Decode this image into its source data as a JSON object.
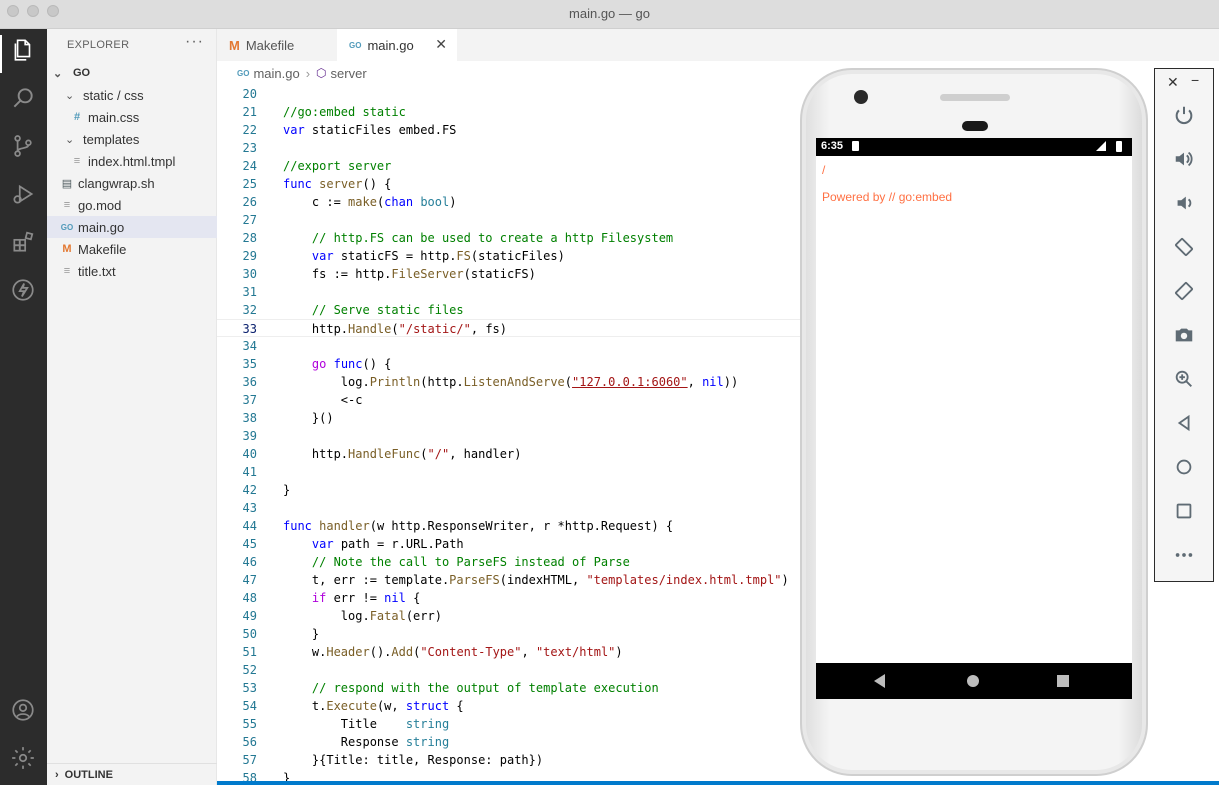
{
  "window": {
    "title": "main.go — go"
  },
  "sidebar": {
    "title": "EXPLORER",
    "more": "···",
    "tree": [
      {
        "label": "GO",
        "type": "root"
      },
      {
        "label": "static / css",
        "type": "folder"
      },
      {
        "label": "main.css",
        "type": "css",
        "glyph": "#"
      },
      {
        "label": "templates",
        "type": "folder"
      },
      {
        "label": "index.html.tmpl",
        "type": "txt",
        "glyph": "≡"
      },
      {
        "label": "clangwrap.sh",
        "type": "sh",
        "glyph": "▤"
      },
      {
        "label": "go.mod",
        "type": "txt",
        "glyph": "≡"
      },
      {
        "label": "main.go",
        "type": "go",
        "glyph": "GO"
      },
      {
        "label": "Makefile",
        "type": "make",
        "glyph": "M"
      },
      {
        "label": "title.txt",
        "type": "txt",
        "glyph": "≡"
      }
    ],
    "outline": "OUTLINE"
  },
  "tabs": [
    {
      "label": "Makefile",
      "icon": "M"
    },
    {
      "label": "main.go",
      "icon": "GO",
      "close": "✕"
    }
  ],
  "breadcrumb": {
    "file": "main.go",
    "symbol": "server"
  },
  "code": {
    "current_line": 33,
    "lines": [
      {
        "n": "20",
        "text": ""
      },
      {
        "n": "21",
        "text": "//go:embed static"
      },
      {
        "n": "22",
        "text": "var staticFiles embed.FS"
      },
      {
        "n": "23",
        "text": ""
      },
      {
        "n": "24",
        "text": "//export server"
      },
      {
        "n": "25",
        "text": "func server() {"
      },
      {
        "n": "26",
        "text": "    c := make(chan bool)"
      },
      {
        "n": "27",
        "text": ""
      },
      {
        "n": "28",
        "text": "    // http.FS can be used to create a http Filesystem"
      },
      {
        "n": "29",
        "text": "    var staticFS = http.FS(staticFiles)"
      },
      {
        "n": "30",
        "text": "    fs := http.FileServer(staticFS)"
      },
      {
        "n": "31",
        "text": ""
      },
      {
        "n": "32",
        "text": "    // Serve static files"
      },
      {
        "n": "33",
        "text": "    http.Handle(\"/static/\", fs)"
      },
      {
        "n": "34",
        "text": ""
      },
      {
        "n": "35",
        "text": "    go func() {"
      },
      {
        "n": "36",
        "text": "        log.Println(http.ListenAndServe(\"127.0.0.1:6060\", nil))"
      },
      {
        "n": "37",
        "text": "        <-c"
      },
      {
        "n": "38",
        "text": "    }()"
      },
      {
        "n": "39",
        "text": ""
      },
      {
        "n": "40",
        "text": "    http.HandleFunc(\"/\", handler)"
      },
      {
        "n": "41",
        "text": ""
      },
      {
        "n": "42",
        "text": "}"
      },
      {
        "n": "43",
        "text": ""
      },
      {
        "n": "44",
        "text": "func handler(w http.ResponseWriter, r *http.Request) {"
      },
      {
        "n": "45",
        "text": "    var path = r.URL.Path"
      },
      {
        "n": "46",
        "text": "    // Note the call to ParseFS instead of Parse"
      },
      {
        "n": "47",
        "text": "    t, err := template.ParseFS(indexHTML, \"templates/index.html.tmpl\")"
      },
      {
        "n": "48",
        "text": "    if err != nil {"
      },
      {
        "n": "49",
        "text": "        log.Fatal(err)"
      },
      {
        "n": "50",
        "text": "    }"
      },
      {
        "n": "51",
        "text": "    w.Header().Add(\"Content-Type\", \"text/html\")"
      },
      {
        "n": "52",
        "text": ""
      },
      {
        "n": "53",
        "text": "    // respond with the output of template execution"
      },
      {
        "n": "54",
        "text": "    t.Execute(w, struct {"
      },
      {
        "n": "55",
        "text": "        Title    string"
      },
      {
        "n": "56",
        "text": "        Response string"
      },
      {
        "n": "57",
        "text": "    }{Title: title, Response: path})"
      },
      {
        "n": "58",
        "text": "}"
      }
    ]
  },
  "phone": {
    "time": "6:35",
    "path": "/",
    "text": "Powered by // go:embed",
    "accent": "#ff7043"
  },
  "emulator": {
    "close": "✕",
    "minimize": "−",
    "buttons": [
      "power-icon",
      "volume-up-icon",
      "volume-down-icon",
      "rotate-left-icon",
      "rotate-right-icon",
      "camera-icon",
      "zoom-icon",
      "back-icon",
      "home-icon",
      "overview-icon",
      "more-icon"
    ]
  },
  "colors": {
    "activity_bar": "#2c2c2c",
    "sidebar": "#f3f3f3",
    "status_bar": "#007acc",
    "line_numbers": "#237893"
  }
}
